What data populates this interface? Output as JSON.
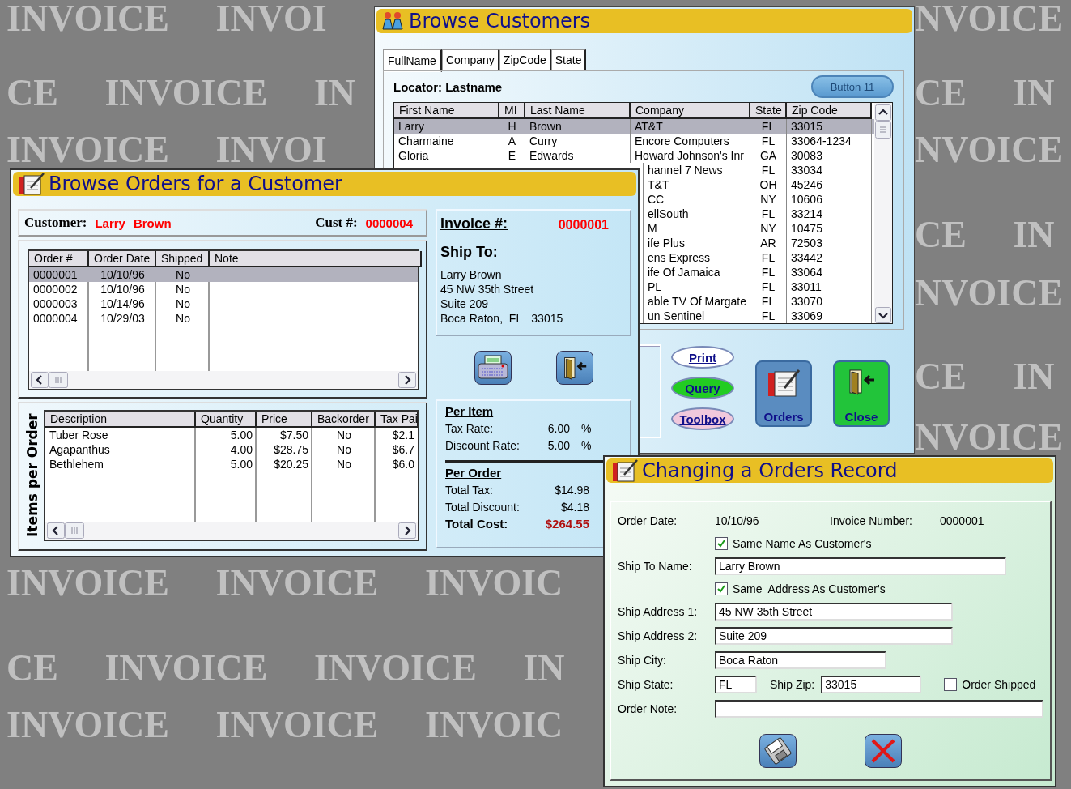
{
  "wallpaper_rows": [
    {
      "left": "INVOICE INVOI",
      "right": "NVOICE"
    },
    {
      "left": "CE INVOICE IN",
      "right": "CE IN"
    },
    {
      "left": "INVOICE INVOI",
      "right": "NVOICE"
    },
    {
      "right": "CE IN"
    },
    {
      "right": "NVOICE"
    },
    {
      "right": "CE IN"
    },
    {
      "right": "NVOICE"
    },
    {
      "left": "INVOICE INVOICE INVOIC"
    },
    {
      "left": "CE INVOICE INVOICE IN"
    },
    {
      "left": "INVOICE INVOICE INVOIC"
    }
  ],
  "customers_window": {
    "title": "Browse Customers",
    "tabs": [
      {
        "label": "FullName",
        "selected": true
      },
      {
        "label": "Company",
        "selected": false
      },
      {
        "label": "ZipCode",
        "selected": false
      },
      {
        "label": "State",
        "selected": false
      }
    ],
    "locator_label": "Locator: Lastname",
    "locator_button": {
      "label": "Button 11",
      "disabled": true
    },
    "grid": {
      "columns": [
        "First Name",
        "MI",
        "Last Name",
        "Company",
        "State",
        "Zip Code"
      ],
      "rows": [
        {
          "first": "Larry",
          "mi": "H",
          "last": "Brown",
          "company": "AT&T",
          "state": "FL",
          "zip": "33015",
          "selected": true
        },
        {
          "first": "Charmaine",
          "mi": "A",
          "last": "Curry",
          "company": "Encore Computers",
          "state": "FL",
          "zip": "33064-1234",
          "selected": false
        },
        {
          "first": "Gloria",
          "mi": "E",
          "last": "Edwards",
          "company": "Howard Johnson's Inr",
          "state": "GA",
          "zip": "30083",
          "selected": false
        },
        {
          "company": "hannel 7 News",
          "state": "FL",
          "zip": "33034",
          "selected": false
        },
        {
          "company": "T&T",
          "state": "OH",
          "zip": "45246",
          "selected": false
        },
        {
          "company": "CC",
          "state": "NY",
          "zip": "10606",
          "selected": false
        },
        {
          "company": "ellSouth",
          "state": "FL",
          "zip": "33214",
          "selected": false
        },
        {
          "company": "M",
          "state": "NY",
          "zip": "10475",
          "selected": false
        },
        {
          "company": "ife Plus",
          "state": "AR",
          "zip": "72503",
          "selected": false
        },
        {
          "company": "ens Express",
          "state": "FL",
          "zip": "33442",
          "selected": false
        },
        {
          "company": "ife Of Jamaica",
          "state": "FL",
          "zip": "33064",
          "selected": false
        },
        {
          "company": "PL",
          "state": "FL",
          "zip": "33011",
          "selected": false
        },
        {
          "company": "able TV Of Margate",
          "state": "FL",
          "zip": "33070",
          "selected": false
        },
        {
          "company": "un Sentinel",
          "state": "FL",
          "zip": "33069",
          "selected": false
        }
      ]
    },
    "oval_buttons": [
      {
        "label": "Print",
        "color": "#ffffff"
      },
      {
        "label": "Query",
        "color": "#22cc22"
      },
      {
        "label": "Toolbox",
        "color": "#f0c8dc"
      }
    ],
    "tile_buttons": [
      {
        "label": "Orders",
        "color": "#5a8cc0"
      },
      {
        "label": "Close",
        "color": "#22c43a"
      }
    ]
  },
  "orders_window": {
    "title": "Browse Orders for a Customer",
    "customer_label": "Customer:",
    "first_name": "Larry",
    "last_name": "Brown",
    "cust_label": "Cust #:",
    "cust_number": "0000004",
    "orders": {
      "columns": [
        "Order #",
        "Order Date",
        "Shipped",
        "Note"
      ],
      "rows": [
        {
          "cells": [
            "0000001",
            "10/10/96",
            "No"
          ],
          "selected": true
        },
        {
          "cells": [
            "0000002",
            "10/10/96",
            "No"
          ],
          "selected": false
        },
        {
          "cells": [
            "0000003",
            "10/14/96",
            "No"
          ],
          "selected": false
        },
        {
          "cells": [
            "0000004",
            "10/29/03",
            "No"
          ],
          "selected": false
        }
      ]
    },
    "items": {
      "side_label": "Items per Order",
      "columns": [
        "Description",
        "Quantity",
        "Price",
        "Backorder",
        "Tax Pai"
      ],
      "rows": [
        [
          "Tuber Rose",
          "5.00",
          "$7.50",
          "No",
          "$2.1"
        ],
        [
          "Agapanthus",
          "4.00",
          "$28.75",
          "No",
          "$6.7"
        ],
        [
          "Bethlehem",
          "5.00",
          "$20.25",
          "No",
          "$6.0"
        ]
      ]
    },
    "invoice_label": "Invoice #:",
    "invoice_number": "0000001",
    "ship_to_label": "Ship To:",
    "ship_to_lines": [
      "Larry Brown",
      "45 NW 35th Street",
      "Suite 209",
      "Boca Raton,  FL   33015"
    ],
    "per_item_label": "Per Item",
    "per_item": [
      {
        "label": "Tax Rate:",
        "value": "6.00",
        "unit": "%"
      },
      {
        "label": "Discount Rate:",
        "value": "5.00",
        "unit": "%"
      }
    ],
    "per_order_label": "Per Order",
    "per_order": [
      {
        "label": "Total Tax:",
        "value": "$14.98",
        "kind": "plain"
      },
      {
        "label": "Total Discount:",
        "value": "$4.18",
        "kind": "plain"
      },
      {
        "label": "Total Cost:",
        "value": "$264.55",
        "kind": "total"
      }
    ]
  },
  "changing_window": {
    "title": "Changing a Orders Record",
    "order_date_label": "Order Date:",
    "order_date": "10/10/96",
    "invoice_label": "Invoice Number:",
    "invoice_number": "0000001",
    "same_name": {
      "label": "Same Name As Customer's",
      "checked": true
    },
    "ship_to_name_label": "Ship To Name:",
    "ship_to_name": "Larry Brown",
    "same_address": {
      "label": "Same  Address As Customer's",
      "checked": true
    },
    "address1_label": "Ship Address 1:",
    "address1": "45 NW 35th Street",
    "address2_label": "Ship Address 2:",
    "address2": "Suite 209",
    "city_label": "Ship City:",
    "city": "Boca Raton",
    "state_label": "Ship State:",
    "state": "FL",
    "zip_label": "Ship Zip:",
    "zip": "33015",
    "shipped": {
      "label": "Order Shipped",
      "checked": false
    },
    "note_label": "Order Note:"
  }
}
